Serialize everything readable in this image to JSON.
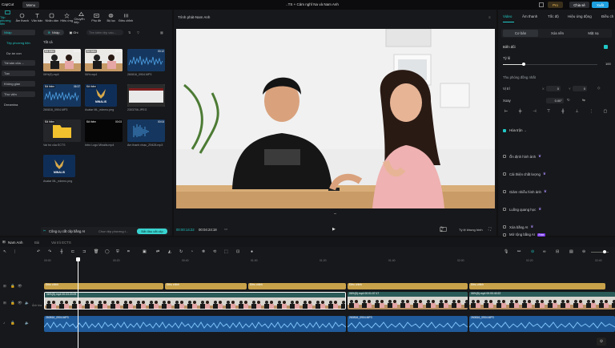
{
  "titlebar": {
    "app_name": "CapCut",
    "menu": "Menu",
    "document_title": "..TS + Cảm nghĩ Na và Nam Anh",
    "pro": "Pro",
    "share": "Chia sẻ",
    "export": "Xuất"
  },
  "toolbar": {
    "items": [
      "Tệp phương tiện",
      "Âm thanh",
      "Văn bản",
      "Nhãn dán",
      "Hiệu ứng",
      "Chuyển tiếp",
      "Phụ đề",
      "Bộ lọc",
      "Điều chỉnh"
    ]
  },
  "leftnav": {
    "items": [
      "Nhập",
      "Tệp phương tiện",
      "Dự án con",
      "Tài sản của ...",
      "Tạo",
      "Không gian",
      "Thư viện",
      "Dreamina"
    ]
  },
  "media": {
    "chips": {
      "import": "Nhập",
      "record": "Ghi",
      "search_placeholder": "Tìm kiếm tệp vào..."
    },
    "all": "Tất cả",
    "added": "Đã thêm",
    "items": [
      {
        "name": "06%(5).mp4",
        "dur": "00:03"
      },
      {
        "name": "06%.mp4",
        "dur": "00:09"
      },
      {
        "name": "260816_0904.MP3",
        "dur": "00:12"
      },
      {
        "name": "260816_0904.MP3",
        "dur": "06:37"
      },
      {
        "name": "Avatar ML_edemo.png",
        "dur": ""
      },
      {
        "name": "2303706.JPEG",
        "dur": ""
      },
      {
        "name": "Vai trò của ECTS",
        "dur": ""
      },
      {
        "name": "Intro Logo Minalis.mp4",
        "dur": "00:03"
      },
      {
        "name": "Âm thanh nhạc_Z9428.mp3",
        "dur": "00:04"
      },
      {
        "name": "Avatar ML_edemo.png",
        "dur": ""
      }
    ],
    "logo_text": "MINALIS",
    "ai_bar": {
      "title": "Công cụ cắt clip bằng AI",
      "hint": "Chọn tệp phương t...",
      "button": "Bắt đầu cắt clip"
    }
  },
  "player": {
    "title": "Trình phát-Nam Anh",
    "time_current": "00:00:14:22",
    "time_total": "00:04:24:18",
    "ratio": "Tỷ lệ",
    "fit": "Tỷ lệ khung hình"
  },
  "right": {
    "tabs": [
      "Video",
      "Âm thanh",
      "Tốc độ",
      "Hiệu ứng động",
      "Điều ch"
    ],
    "subtabs": [
      "Cơ bản",
      "Xóa nền",
      "Mặt nạ"
    ],
    "transform": "Biến đổi",
    "scale_label": "Tỷ lệ",
    "scale_value": "100",
    "uniform": "Thu phóng đồng nhất",
    "position": "Vị trí",
    "pos_x": "0",
    "pos_y": "0",
    "rotate": "Xoay",
    "rotate_value": "0.00°",
    "blend": "Hòa trộn",
    "options": [
      "Ổn định hình ảnh",
      "Cải thiện chất lượng",
      "Giảm nhiễu hình ảnh",
      "Luồng quang học",
      "Xóa bằng AI",
      "Mở rộng bằng AI"
    ],
    "free_badge": "Free"
  },
  "timeline": {
    "tab": "Nam Anh",
    "subtabs": [
      "Bài",
      "Vai trò ECTS"
    ],
    "ticks": [
      "00:00",
      "00:20",
      "00:40",
      "01:00",
      "01:20",
      "01:40",
      "02:00",
      "02:20",
      "02:40"
    ],
    "effect_label": "Điều chỉnh",
    "video_clip": "06%(5).mp4  00:03:20:09",
    "video_clip2": "06%(5).mp4  00:01:07:17",
    "video_clip3": "06%(5).mp4  00:00:40:22",
    "audio_clip": "260816_0904.MP3",
    "cover": "Ảnh bìa"
  },
  "colors": {
    "accent": "#21c8c6",
    "effect": "#c8a24a",
    "audio": "#1f5b9b"
  }
}
